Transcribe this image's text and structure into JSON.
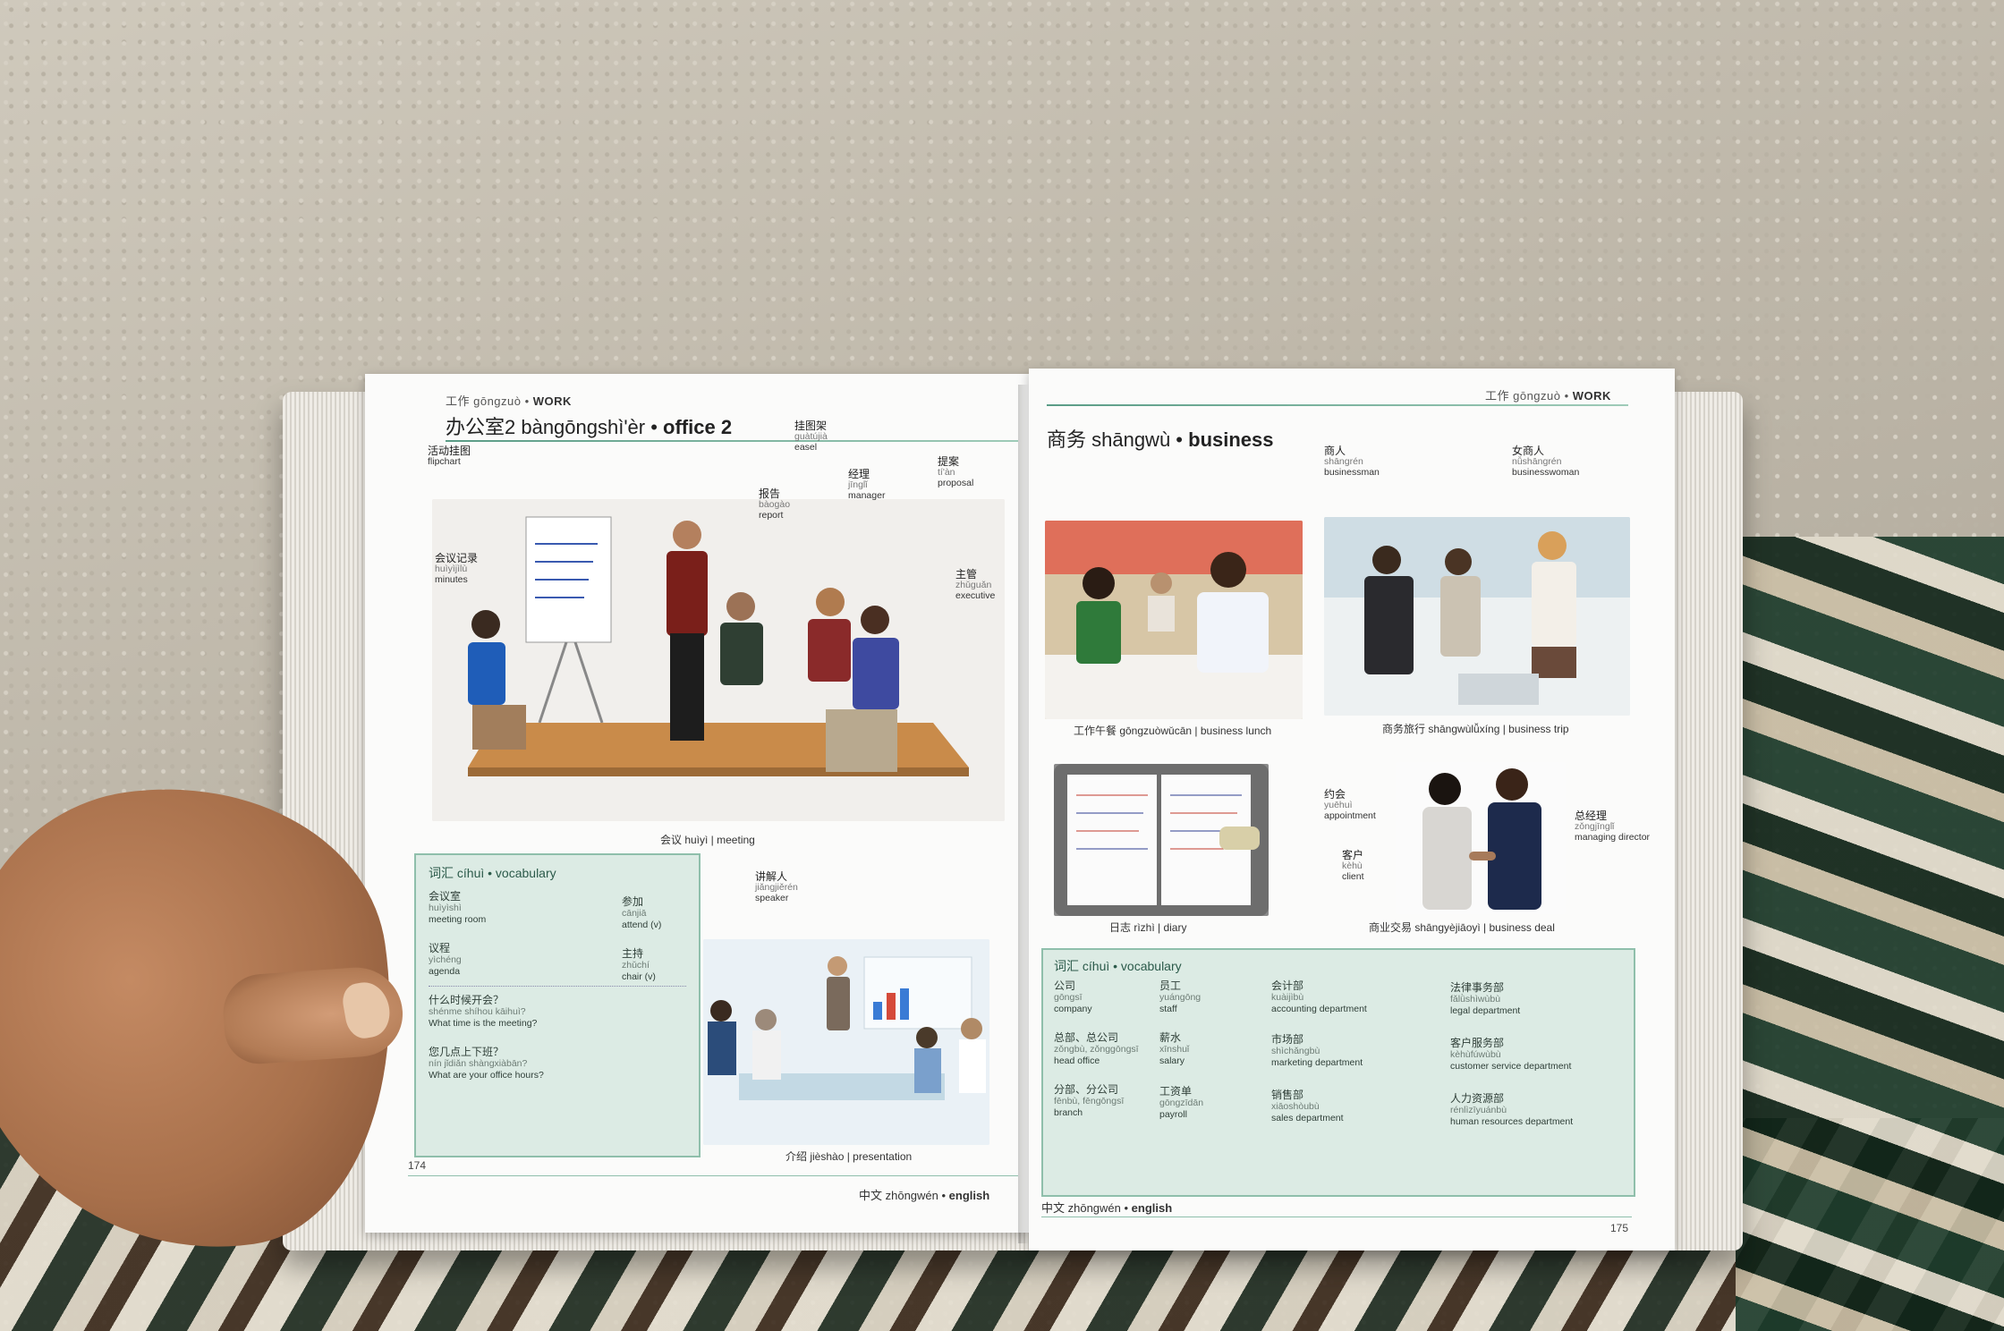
{
  "left_page": {
    "running_head_zh": "工作 gōngzuò",
    "running_head_en": "WORK",
    "title_zh": "办公室2 bàngōngshì'èr",
    "title_en": "office 2",
    "labels": [
      {
        "zh": "活动挂图",
        "py": "",
        "en": "flipchart"
      },
      {
        "zh": "挂图架",
        "py": "guàtújià",
        "en": "easel"
      },
      {
        "zh": "经理",
        "py": "jīnglǐ",
        "en": "manager"
      },
      {
        "zh": "报告",
        "py": "bàogào",
        "en": "report"
      },
      {
        "zh": "提案",
        "py": "tí'àn",
        "en": "proposal"
      },
      {
        "zh": "会议记录",
        "py": "huìyìjìlù",
        "en": "minutes"
      },
      {
        "zh": "主管",
        "py": "zhǔguǎn",
        "en": "executive"
      }
    ],
    "caption_meeting": "会议 huìyì | meeting",
    "caption_presentation": "介绍 jièshào | presentation",
    "speaker": {
      "zh": "讲解人",
      "py": "jiǎngjiěrén",
      "en": "speaker"
    },
    "vocab_head": "词汇 cíhuì • vocabulary",
    "vocab": [
      {
        "zh": "会议室",
        "py": "huìyìshì",
        "en": "meeting room"
      },
      {
        "zh": "参加",
        "py": "cānjiā",
        "en": "attend (v)"
      },
      {
        "zh": "议程",
        "py": "yìchéng",
        "en": "agenda"
      },
      {
        "zh": "主持",
        "py": "zhǔchí",
        "en": "chair (v)"
      }
    ],
    "phrases": [
      {
        "zh": "什么时候开会？",
        "py": "shénme shíhou kāihuì?",
        "en": "What time is the meeting?"
      },
      {
        "zh": "您几点上下班？",
        "py": "nín jǐdiǎn shàngxiàbān?",
        "en": "What are your office hours?"
      }
    ],
    "page_number": "174",
    "footer_zh": "中文 zhōngwén",
    "footer_en": "english"
  },
  "right_page": {
    "running_head_zh": "工作 gōngzuò",
    "running_head_en": "WORK",
    "title_zh": "商务 shāngwù",
    "title_en": "business",
    "labels": [
      {
        "zh": "商人",
        "py": "shāngrén",
        "en": "businessman"
      },
      {
        "zh": "女商人",
        "py": "nǚshāngrén",
        "en": "businesswoman"
      },
      {
        "zh": "约会",
        "py": "yuēhuì",
        "en": "appointment"
      },
      {
        "zh": "客户",
        "py": "kèhù",
        "en": "client"
      },
      {
        "zh": "总经理",
        "py": "zǒngjīnglǐ",
        "en": "managing director"
      }
    ],
    "caption_lunch": "工作午餐 gōngzuòwǔcān | business lunch",
    "caption_trip": "商务旅行 shāngwùlǚxíng | business trip",
    "caption_diary": "日志 rìzhì | diary",
    "caption_deal": "商业交易 shāngyèjiāoyì | business deal",
    "vocab_head": "词汇 cíhuì • vocabulary",
    "vocab": [
      {
        "zh": "公司",
        "py": "gōngsī",
        "en": "company"
      },
      {
        "zh": "员工",
        "py": "yuángōng",
        "en": "staff"
      },
      {
        "zh": "会计部",
        "py": "kuàijìbù",
        "en": "accounting department"
      },
      {
        "zh": "法律事务部",
        "py": "fǎlǜshìwùbù",
        "en": "legal department"
      },
      {
        "zh": "总部、总公司",
        "py": "zǒngbù, zǒnggōngsī",
        "en": "head office"
      },
      {
        "zh": "薪水",
        "py": "xīnshuǐ",
        "en": "salary"
      },
      {
        "zh": "市场部",
        "py": "shìchǎngbù",
        "en": "marketing department"
      },
      {
        "zh": "客户服务部",
        "py": "kèhùfúwùbù",
        "en": "customer service department"
      },
      {
        "zh": "分部、分公司",
        "py": "fēnbù, fēngōngsī",
        "en": "branch"
      },
      {
        "zh": "工资单",
        "py": "gōngzīdān",
        "en": "payroll"
      },
      {
        "zh": "销售部",
        "py": "xiāoshòubù",
        "en": "sales department"
      },
      {
        "zh": "人力资源部",
        "py": "rénlìzīyuánbù",
        "en": "human resources department"
      }
    ],
    "page_number": "175",
    "footer_zh": "中文 zhōngwén",
    "footer_en": "english"
  },
  "colors": {
    "accent": "#5a9c86",
    "vocab_bg": "#dcebe4",
    "vocab_border": "#8fbfab"
  }
}
